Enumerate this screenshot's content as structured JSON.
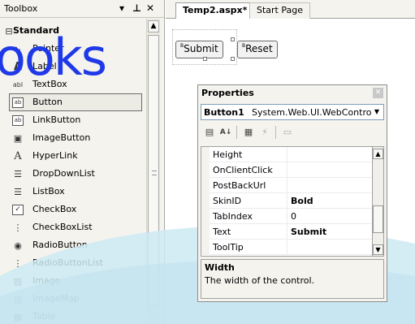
{
  "toolbox": {
    "title": "Toolbox",
    "controls": {
      "dropdown": "▾",
      "pin": "ꟷ",
      "close": "✕"
    },
    "section": {
      "toggle": "⊟",
      "label": "Standard"
    },
    "items": [
      {
        "label": "Pointer",
        "icon": "pointer-icon",
        "glyph": "➘"
      },
      {
        "label": "Label",
        "icon": "label-icon",
        "glyph": "A"
      },
      {
        "label": "TextBox",
        "icon": "textbox-icon",
        "glyph": "abl"
      },
      {
        "label": "Button",
        "icon": "button-icon",
        "glyph": "ab"
      },
      {
        "label": "LinkButton",
        "icon": "linkbutton-icon",
        "glyph": "ab"
      },
      {
        "label": "ImageButton",
        "icon": "imagebutton-icon",
        "glyph": "▣"
      },
      {
        "label": "HyperLink",
        "icon": "hyperlink-icon",
        "glyph": "A"
      },
      {
        "label": "DropDownList",
        "icon": "dropdownlist-icon",
        "glyph": "☰"
      },
      {
        "label": "ListBox",
        "icon": "listbox-icon",
        "glyph": "☰"
      },
      {
        "label": "CheckBox",
        "icon": "checkbox-icon",
        "glyph": "✓"
      },
      {
        "label": "CheckBoxList",
        "icon": "checkboxlist-icon",
        "glyph": "⋮"
      },
      {
        "label": "RadioButton",
        "icon": "radiobutton-icon",
        "glyph": "◉"
      },
      {
        "label": "RadioButtonList",
        "icon": "radiobuttonlist-icon",
        "glyph": "⋮"
      },
      {
        "label": "Image",
        "icon": "image-icon",
        "glyph": "▨"
      },
      {
        "label": "ImageMap",
        "icon": "imagemap-icon",
        "glyph": "▨"
      },
      {
        "label": "Table",
        "icon": "table-icon",
        "glyph": "▦"
      }
    ]
  },
  "watermark": "ooks",
  "tabs": [
    {
      "label": "Temp2.aspx*"
    },
    {
      "label": "Start Page"
    }
  ],
  "design": {
    "button_mark": "B",
    "submit_label": "Submit",
    "reset_label": "Reset"
  },
  "properties": {
    "title": "Properties",
    "close": "✕",
    "object_name": "Button1",
    "object_type": "System.Web.UI.WebContro",
    "rows": [
      {
        "name": "Height",
        "value": ""
      },
      {
        "name": "OnClientClick",
        "value": ""
      },
      {
        "name": "PostBackUrl",
        "value": ""
      },
      {
        "name": "SkinID",
        "value": "Bold"
      },
      {
        "name": "TabIndex",
        "value": "0"
      },
      {
        "name": "Text",
        "value": "Submit"
      },
      {
        "name": "ToolTip",
        "value": ""
      }
    ],
    "description_title": "Width",
    "description_text": "The width of the control."
  },
  "colors": {
    "watermark": "#1f39e8",
    "swoosh": "#bfe3ef"
  }
}
